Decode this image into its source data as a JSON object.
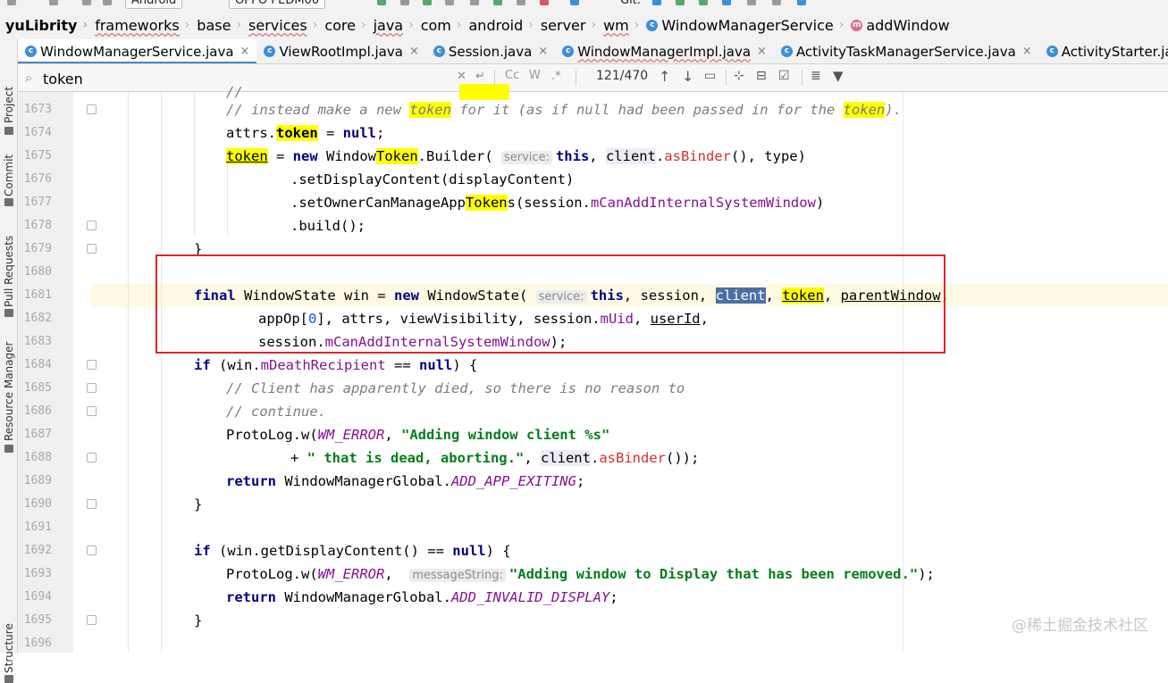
{
  "toolbar": {
    "run_config": "Android",
    "device": "OPPO PEDM00",
    "git_label": "Git:"
  },
  "breadcrumb": {
    "project": "yuLibrity",
    "items": [
      "frameworks",
      "base",
      "services",
      "core",
      "java",
      "com",
      "android",
      "server",
      "wm"
    ],
    "class_name": "WindowManagerService",
    "method_name": "addWindow"
  },
  "left_panel": {
    "project": "Project",
    "commit": "Commit",
    "pull_requests": "Pull Requests",
    "resource_manager": "Resource Manager",
    "structure": "Structure"
  },
  "tabs": [
    {
      "label": "WindowManagerService.java",
      "active": true
    },
    {
      "label": "ViewRootImpl.java",
      "active": false
    },
    {
      "label": "Session.java",
      "active": false
    },
    {
      "label": "WindowManagerImpl.java",
      "active": false
    },
    {
      "label": "ActivityTaskManagerService.java",
      "active": false
    },
    {
      "label": "ActivityStarter.java",
      "active": false
    }
  ],
  "search": {
    "query": "token",
    "match_count": "121/470",
    "case_label": "Cc",
    "word_label": "W"
  },
  "editor": {
    "line_numbers": [
      "1673",
      "1674",
      "1675",
      "1676",
      "1677",
      "1678",
      "1679",
      "1680",
      "1681",
      "1682",
      "1683",
      "1684",
      "1685",
      "1686",
      "1687",
      "1688",
      "1689",
      "1690",
      "1691",
      "1692",
      "1693",
      "1694",
      "1695",
      "1696"
    ],
    "current_line": "1681",
    "hints": {
      "service": "service:",
      "message_string": "messageString:"
    }
  },
  "watermark": "@稀土掘金技术社区"
}
